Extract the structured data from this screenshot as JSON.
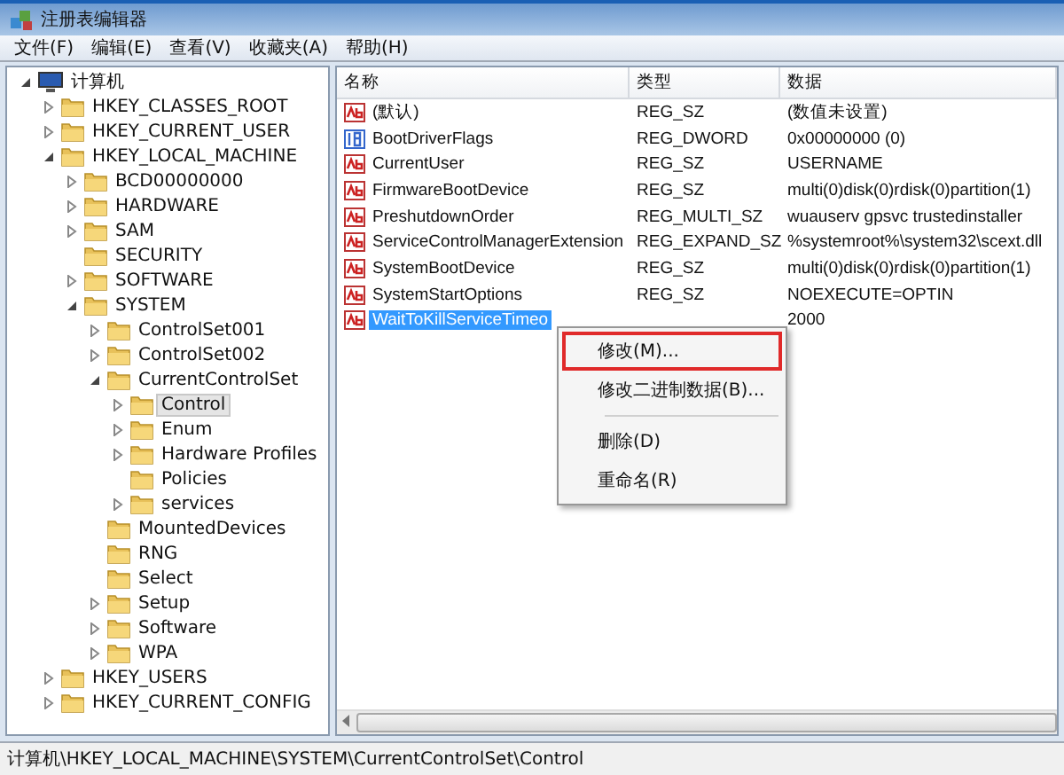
{
  "window": {
    "title": "注册表编辑器"
  },
  "menu": [
    "文件(F)",
    "编辑(E)",
    "查看(V)",
    "收藏夹(A)",
    "帮助(H)"
  ],
  "tree": [
    {
      "label": "计算机",
      "kind": "computer",
      "expanded": true,
      "selected": false,
      "children": [
        {
          "label": "HKEY_CLASSES_ROOT",
          "expanded": false,
          "selected": false
        },
        {
          "label": "HKEY_CURRENT_USER",
          "expanded": false,
          "selected": false
        },
        {
          "label": "HKEY_LOCAL_MACHINE",
          "expanded": true,
          "selected": false,
          "children": [
            {
              "label": "BCD00000000",
              "expanded": false,
              "selected": false
            },
            {
              "label": "HARDWARE",
              "expanded": false,
              "selected": false
            },
            {
              "label": "SAM",
              "expanded": false,
              "selected": false
            },
            {
              "label": "SECURITY",
              "selected": false
            },
            {
              "label": "SOFTWARE",
              "expanded": false,
              "selected": false
            },
            {
              "label": "SYSTEM",
              "expanded": true,
              "selected": false,
              "children": [
                {
                  "label": "ControlSet001",
                  "expanded": false,
                  "selected": false
                },
                {
                  "label": "ControlSet002",
                  "expanded": false,
                  "selected": false
                },
                {
                  "label": "CurrentControlSet",
                  "expanded": true,
                  "selected": false,
                  "children": [
                    {
                      "label": "Control",
                      "expanded": false,
                      "selected": true
                    },
                    {
                      "label": "Enum",
                      "expanded": false,
                      "selected": false
                    },
                    {
                      "label": "Hardware Profiles",
                      "expanded": false,
                      "selected": false
                    },
                    {
                      "label": "Policies",
                      "selected": false
                    },
                    {
                      "label": "services",
                      "expanded": false,
                      "selected": false
                    }
                  ]
                },
                {
                  "label": "MountedDevices",
                  "selected": false
                },
                {
                  "label": "RNG",
                  "selected": false
                },
                {
                  "label": "Select",
                  "selected": false
                },
                {
                  "label": "Setup",
                  "expanded": false,
                  "selected": false
                },
                {
                  "label": "Software",
                  "expanded": false,
                  "selected": false
                },
                {
                  "label": "WPA",
                  "expanded": false,
                  "selected": false
                }
              ]
            }
          ]
        },
        {
          "label": "HKEY_USERS",
          "expanded": false,
          "selected": false
        },
        {
          "label": "HKEY_CURRENT_CONFIG",
          "expanded": false,
          "selected": false
        }
      ]
    }
  ],
  "table": {
    "columns": [
      "名称",
      "类型",
      "数据"
    ],
    "rows": [
      {
        "kind": "string",
        "name": "(默认)",
        "type": "REG_SZ",
        "data": "(数值未设置)",
        "selected": false
      },
      {
        "kind": "number",
        "name": "BootDriverFlags",
        "type": "REG_DWORD",
        "data": "0x00000000 (0)",
        "selected": false
      },
      {
        "kind": "string",
        "name": "CurrentUser",
        "type": "REG_SZ",
        "data": "USERNAME",
        "selected": false
      },
      {
        "kind": "string",
        "name": "FirmwareBootDevice",
        "type": "REG_SZ",
        "data": "multi(0)disk(0)rdisk(0)partition(1)",
        "selected": false
      },
      {
        "kind": "string",
        "name": "PreshutdownOrder",
        "type": "REG_MULTI_SZ",
        "data": "wuauserv gpsvc trustedinstaller",
        "selected": false
      },
      {
        "kind": "string",
        "name": "ServiceControlManagerExtension",
        "type": "REG_EXPAND_SZ",
        "data": "%systemroot%\\system32\\scext.dll",
        "selected": false
      },
      {
        "kind": "string",
        "name": "SystemBootDevice",
        "type": "REG_SZ",
        "data": "multi(0)disk(0)rdisk(0)partition(1)",
        "selected": false
      },
      {
        "kind": "string",
        "name": "SystemStartOptions",
        "type": "REG_SZ",
        "data": " NOEXECUTE=OPTIN",
        "selected": false
      },
      {
        "kind": "string",
        "name": "WaitToKillServiceTimeo",
        "data": "2000",
        "selected": true
      }
    ]
  },
  "context_menu": {
    "items": [
      {
        "label": "修改(M)...",
        "highlighted": true,
        "separator_after": false
      },
      {
        "label": "修改二进制数据(B)...",
        "highlighted": false,
        "separator_after": true
      },
      {
        "label": "删除(D)",
        "highlighted": false,
        "separator_after": false
      },
      {
        "label": "重命名(R)",
        "highlighted": false,
        "separator_after": false
      }
    ]
  },
  "status_bar": {
    "path": "计算机\\HKEY_LOCAL_MACHINE\\SYSTEM\\CurrentControlSet\\Control"
  }
}
